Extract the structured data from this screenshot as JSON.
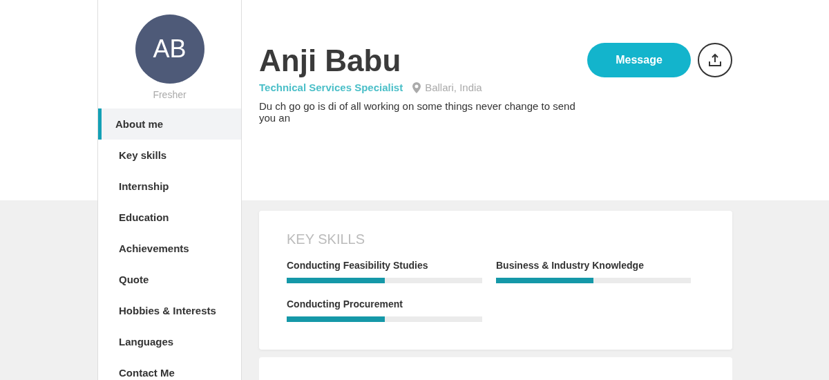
{
  "sidebar": {
    "avatar_initials": "AB",
    "status": "Fresher",
    "items": [
      {
        "label": "About me",
        "selected": true
      },
      {
        "label": "Key skills",
        "selected": false
      },
      {
        "label": "Internship",
        "selected": false
      },
      {
        "label": "Education",
        "selected": false
      },
      {
        "label": "Achievements",
        "selected": false
      },
      {
        "label": "Quote",
        "selected": false
      },
      {
        "label": "Hobbies & Interests",
        "selected": false
      },
      {
        "label": "Languages",
        "selected": false
      },
      {
        "label": "Contact Me",
        "selected": false
      }
    ]
  },
  "header": {
    "name": "Anji Babu",
    "job_title": "Technical Services Specialist",
    "location": "Ballari, India",
    "bio": "Du ch go go is di of all working on some things never change to send you an",
    "message_button": "Message"
  },
  "key_skills": {
    "heading": "KEY SKILLS",
    "skills": [
      {
        "name": "Conducting Feasibility Studies",
        "level": 0.5
      },
      {
        "name": "Business & Industry Knowledge",
        "level": 0.5
      },
      {
        "name": "Conducting Procurement",
        "level": 0.5
      }
    ]
  }
}
